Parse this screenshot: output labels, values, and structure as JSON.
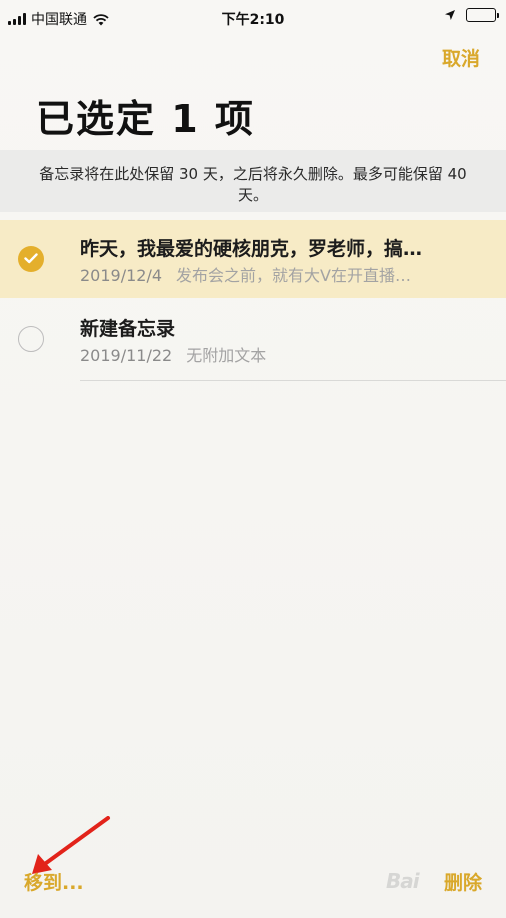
{
  "status_bar": {
    "carrier": "中国联通",
    "time": "下午2:10"
  },
  "nav": {
    "cancel_label": "取消",
    "title": "已选定 1 项"
  },
  "notice": {
    "text": "备忘录将在此处保留 30 天，之后将永久删除。最多可能保留 40 天。"
  },
  "notes": [
    {
      "title": "昨天，我最爱的硬核朋克，罗老师，搞…",
      "date": "2019/12/4",
      "preview": "发布会之前，就有大V在开直播…",
      "selected": true
    },
    {
      "title": "新建备忘录",
      "date": "2019/11/22",
      "preview": "无附加文本",
      "selected": false
    }
  ],
  "toolbar": {
    "move_label": "移到...",
    "delete_label": "删除"
  },
  "colors": {
    "accent": "#d9a82b",
    "selected_row": "#f7ebc6",
    "checkmark_fill": "#e4af2c",
    "annotation_arrow": "#e2231a"
  },
  "icons": {
    "signal": "cellular-signal-icon",
    "wifi": "wifi-icon",
    "location": "location-arrow-icon",
    "battery": "battery-icon",
    "check": "checkmark-icon"
  }
}
